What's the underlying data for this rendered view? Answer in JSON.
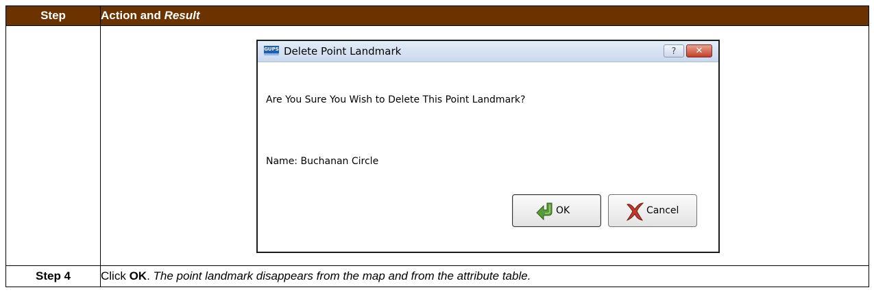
{
  "table": {
    "header_step": "Step",
    "header_action_plain": "Action and ",
    "header_action_italic": "Result"
  },
  "dialog": {
    "app_icon_text": "GUPS",
    "title": "Delete Point Landmark",
    "help_symbol": "?",
    "close_symbol": "✕",
    "message": "Are You Sure You Wish to Delete This Point Landmark?",
    "name_line": "Name: Buchanan Circle",
    "ok_label": "OK",
    "cancel_label": "Cancel"
  },
  "step_row": {
    "label": "Step 4",
    "text_prefix": "Click ",
    "text_bold": "OK",
    "text_period": ". ",
    "text_italic": "The point landmark disappears from the map and from the attribute table."
  },
  "colors": {
    "header_background": "#6b3300",
    "header_text": "#ffffff"
  }
}
